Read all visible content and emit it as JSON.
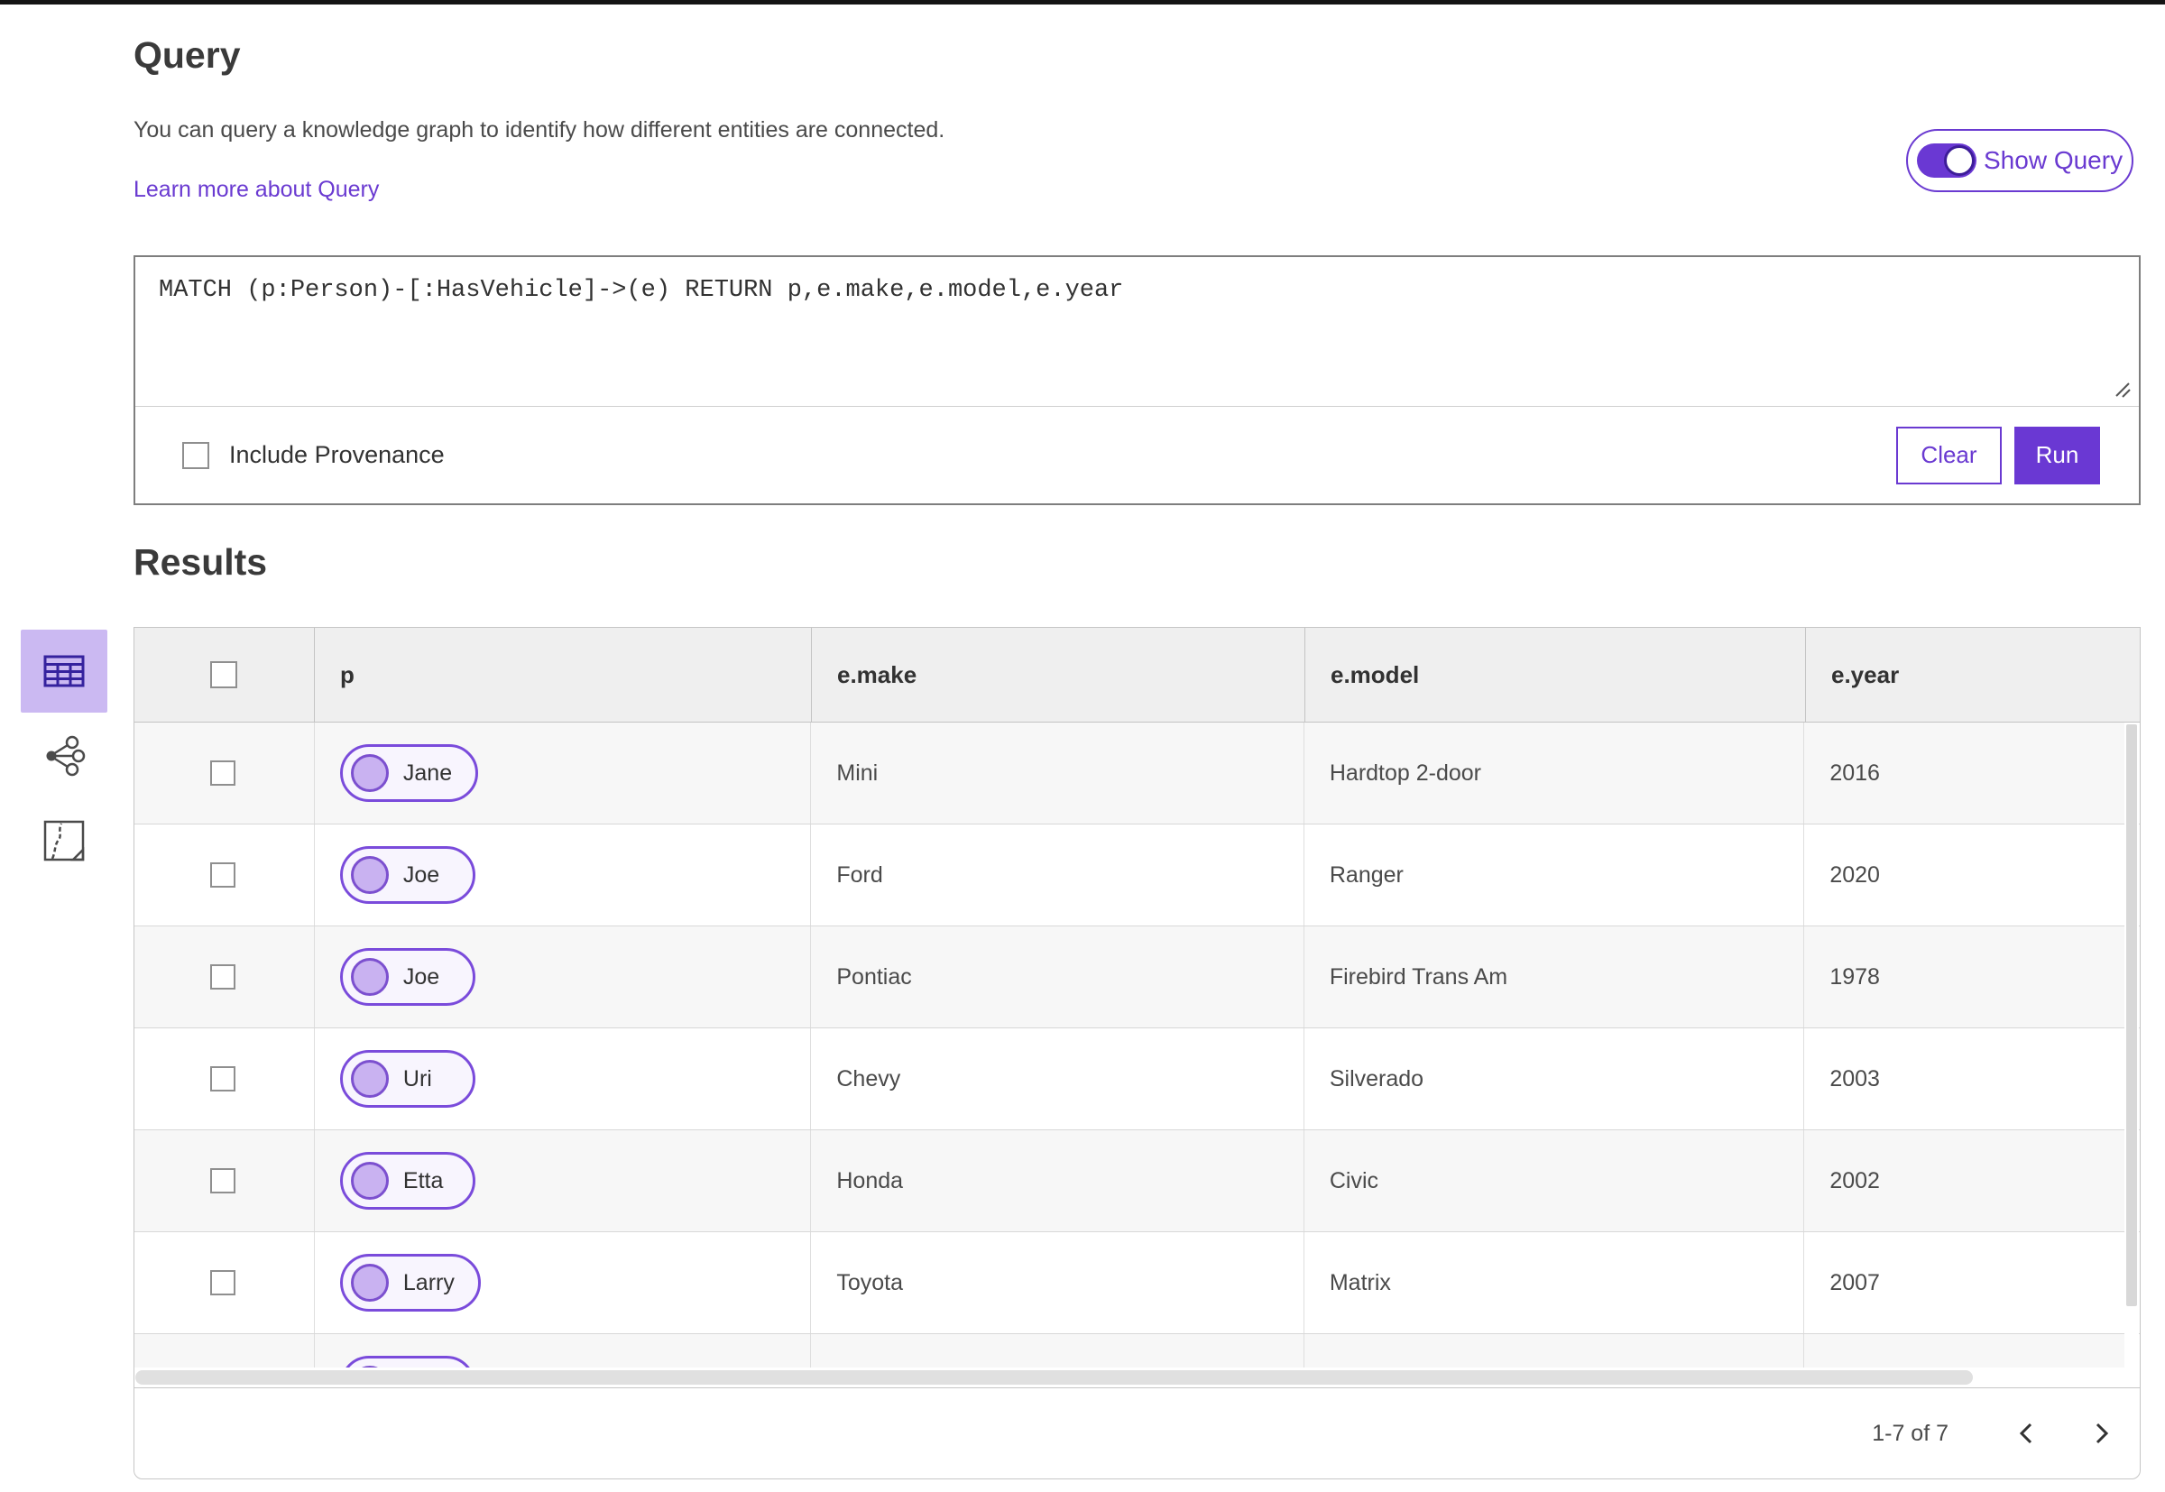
{
  "header": {
    "title": "Query",
    "description": "You can query a knowledge graph to identify how different entities are connected.",
    "learn_more_link": "Learn more about Query",
    "show_query_toggle": {
      "label": "Show Query",
      "state": "on"
    }
  },
  "query_editor": {
    "query_text": "MATCH (p:Person)-[:HasVehicle]->(e) RETURN p,e.make,e.model,e.year",
    "include_provenance": {
      "label": "Include Provenance",
      "checked": false
    },
    "clear_button_label": "Clear",
    "run_button_label": "Run"
  },
  "results": {
    "title": "Results",
    "view_switcher": [
      {
        "icon": "table-icon",
        "selected": true
      },
      {
        "icon": "link-chart-icon",
        "selected": false
      },
      {
        "icon": "map-icon",
        "selected": false
      }
    ],
    "table": {
      "columns": [
        "p",
        "e.make",
        "e.model",
        "e.year"
      ],
      "rows": [
        {
          "name": "Jane",
          "make": "Mini",
          "model": "Hardtop 2-door",
          "year": "2016",
          "partial": false
        },
        {
          "name": "Joe",
          "make": "Ford",
          "model": "Ranger",
          "year": "2020",
          "partial": false
        },
        {
          "name": "Joe",
          "make": "Pontiac",
          "model": "Firebird Trans Am",
          "year": "1978",
          "partial": false
        },
        {
          "name": "Uri",
          "make": "Chevy",
          "model": "Silverado",
          "year": "2003",
          "partial": false
        },
        {
          "name": "Etta",
          "make": "Honda",
          "model": "Civic",
          "year": "2002",
          "partial": false
        },
        {
          "name": "Larry",
          "make": "Toyota",
          "model": "Matrix",
          "year": "2007",
          "partial": false
        },
        {
          "name": "",
          "make": "",
          "model": "",
          "year": "",
          "partial": true
        }
      ],
      "all_checked": false
    },
    "pagination": {
      "range_label": "1-7 of 7"
    }
  },
  "colors": {
    "accent": "#6a3ad1",
    "accent_fill": "#6a38d3",
    "rail_selected": "#cbb9f2",
    "pill_border": "#7a4bdb",
    "pill_bg": "#f8f5fe",
    "pill_circle": "#c9b2f1",
    "header_bg": "#efefef",
    "row_alt": "#f7f7f7",
    "text_dark": "#3a3a3a",
    "text_body": "#4a4a4a"
  }
}
